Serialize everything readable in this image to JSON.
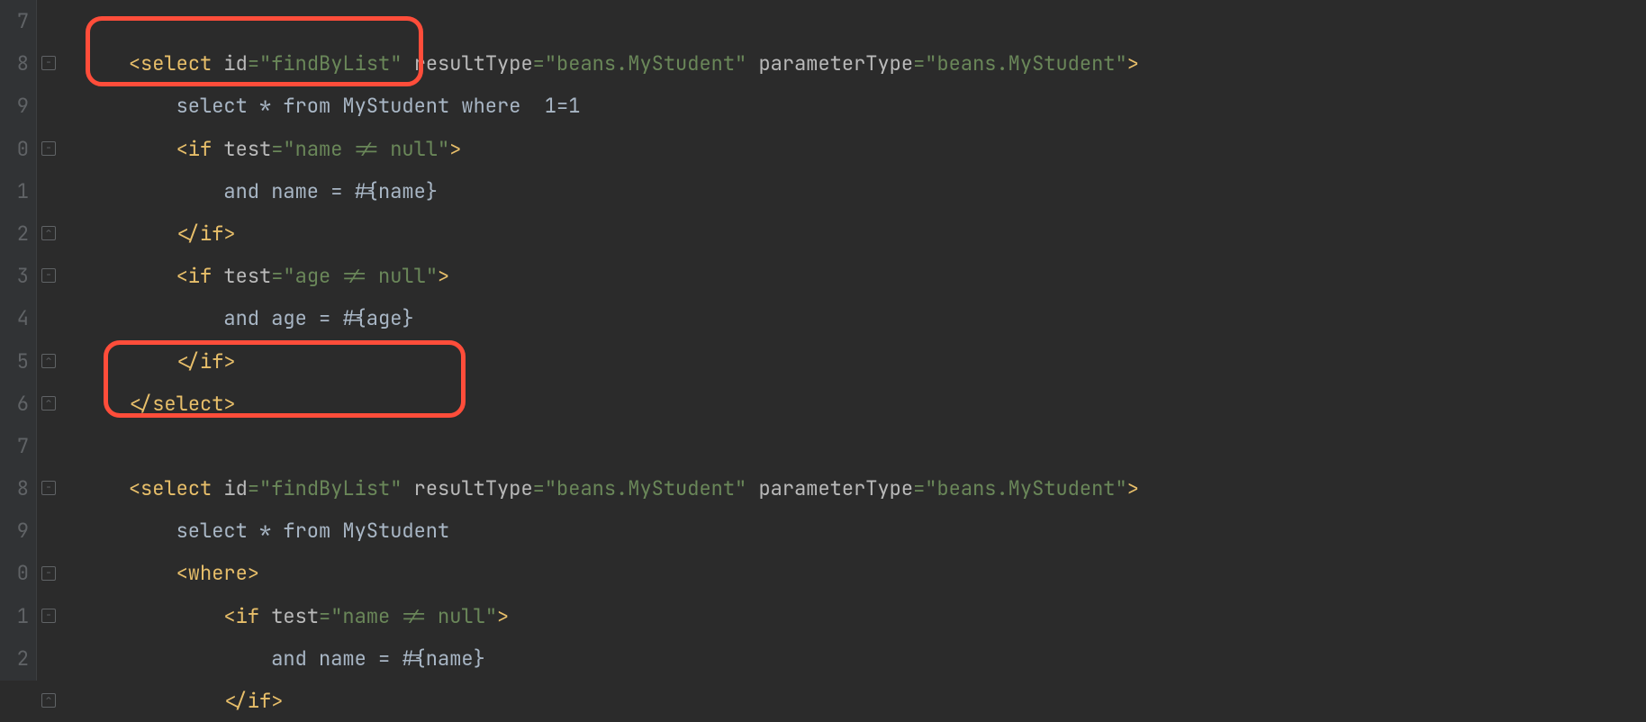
{
  "lineNumbers": [
    "7",
    "8",
    "9",
    "0",
    "1",
    "2",
    "3",
    "4",
    "5",
    "6",
    "7",
    "8",
    "9",
    "0",
    "1",
    "2"
  ],
  "folds": [
    {
      "row": 1,
      "glyph": "−"
    },
    {
      "row": 3,
      "glyph": "−"
    },
    {
      "row": 5,
      "glyph": "⌃"
    },
    {
      "row": 6,
      "glyph": "−"
    },
    {
      "row": 8,
      "glyph": "⌃"
    },
    {
      "row": 9,
      "glyph": "⌃"
    },
    {
      "row": 11,
      "glyph": "−"
    },
    {
      "row": 13,
      "glyph": "−"
    },
    {
      "row": 14,
      "glyph": "−"
    },
    {
      "row": 16,
      "glyph": "⌃"
    }
  ],
  "code": [
    [
      {
        "c": "txt",
        "t": ""
      }
    ],
    [
      {
        "c": "txt",
        "t": "    "
      },
      {
        "c": "tag",
        "t": "<select "
      },
      {
        "c": "attr",
        "t": "id"
      },
      {
        "c": "val",
        "t": "=\"findByList\" "
      },
      {
        "c": "attr",
        "t": "resultType"
      },
      {
        "c": "val",
        "t": "=\"beans.MyStudent\" "
      },
      {
        "c": "attr",
        "t": "parameterType"
      },
      {
        "c": "val",
        "t": "=\"beans.MyStudent\""
      },
      {
        "c": "tag",
        "t": ">"
      }
    ],
    [
      {
        "c": "txt",
        "t": "        select * from MyStudent where  1=1"
      }
    ],
    [
      {
        "c": "txt",
        "t": "        "
      },
      {
        "c": "tag",
        "t": "<if "
      },
      {
        "c": "attr",
        "t": "test"
      },
      {
        "c": "val",
        "t": "=\"name != null\""
      },
      {
        "c": "tag",
        "t": ">"
      }
    ],
    [
      {
        "c": "txt",
        "t": "            and name = #{name}"
      }
    ],
    [
      {
        "c": "txt",
        "t": "        "
      },
      {
        "c": "tag",
        "t": "</if>"
      }
    ],
    [
      {
        "c": "txt",
        "t": "        "
      },
      {
        "c": "tag",
        "t": "<if "
      },
      {
        "c": "attr",
        "t": "test"
      },
      {
        "c": "val",
        "t": "=\"age != null\""
      },
      {
        "c": "tag",
        "t": ">"
      }
    ],
    [
      {
        "c": "txt",
        "t": "            and age = #{age}"
      }
    ],
    [
      {
        "c": "txt",
        "t": "        "
      },
      {
        "c": "tag",
        "t": "</if>"
      }
    ],
    [
      {
        "c": "txt",
        "t": "    "
      },
      {
        "c": "tag",
        "t": "</select>"
      }
    ],
    [
      {
        "c": "txt",
        "t": ""
      }
    ],
    [
      {
        "c": "txt",
        "t": "    "
      },
      {
        "c": "tag",
        "t": "<select "
      },
      {
        "c": "attr",
        "t": "id"
      },
      {
        "c": "val",
        "t": "=\"findByList\" "
      },
      {
        "c": "attr",
        "t": "resultType"
      },
      {
        "c": "val",
        "t": "=\"beans.MyStudent\" "
      },
      {
        "c": "attr",
        "t": "parameterType"
      },
      {
        "c": "val",
        "t": "=\"beans.MyStudent\""
      },
      {
        "c": "tag",
        "t": ">"
      }
    ],
    [
      {
        "c": "txt",
        "t": "        select * from MyStudent"
      }
    ],
    [
      {
        "c": "txt",
        "t": "        "
      },
      {
        "c": "tag",
        "t": "<where>"
      }
    ],
    [
      {
        "c": "txt",
        "t": "            "
      },
      {
        "c": "tag",
        "t": "<if "
      },
      {
        "c": "attr",
        "t": "test"
      },
      {
        "c": "val",
        "t": "=\"name != null\""
      },
      {
        "c": "tag",
        "t": ">"
      }
    ],
    [
      {
        "c": "txt",
        "t": "                and name = #{name}"
      }
    ],
    [
      {
        "c": "txt",
        "t": "            "
      },
      {
        "c": "tag",
        "t": "</if>"
      }
    ]
  ]
}
